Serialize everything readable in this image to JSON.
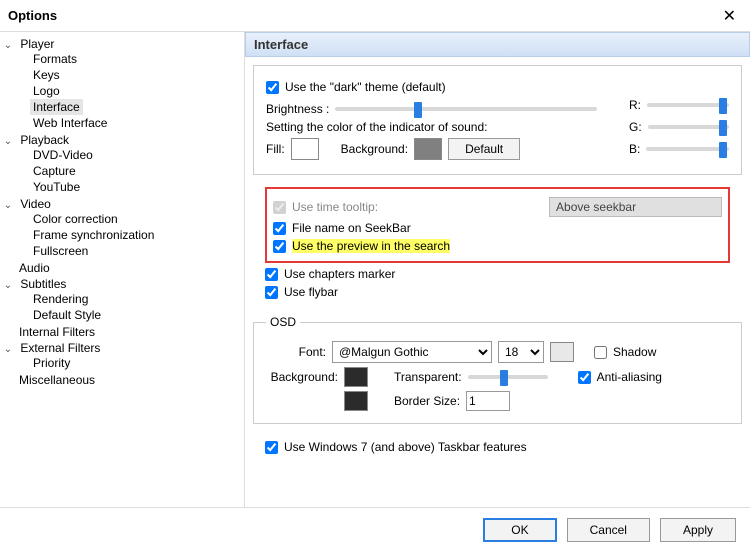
{
  "window": {
    "title": "Options",
    "close": "✕"
  },
  "tree": {
    "player": {
      "label": "Player",
      "items": [
        "Formats",
        "Keys",
        "Logo",
        "Interface",
        "Web Interface"
      ]
    },
    "playback": {
      "label": "Playback",
      "items": [
        "DVD-Video",
        "Capture",
        "YouTube"
      ]
    },
    "video": {
      "label": "Video",
      "items": [
        "Color correction",
        "Frame synchronization",
        "Fullscreen"
      ]
    },
    "audio": {
      "label": "Audio"
    },
    "subtitles": {
      "label": "Subtitles",
      "items": [
        "Rendering",
        "Default Style"
      ]
    },
    "internal_filters": {
      "label": "Internal Filters"
    },
    "external_filters": {
      "label": "External Filters",
      "items": [
        "Priority"
      ]
    },
    "misc": {
      "label": "Miscellaneous"
    }
  },
  "header": "Interface",
  "theme": {
    "dark_label": "Use the \"dark\" theme (default)",
    "brightness_label": "Brightness :",
    "color_setting_label": "Setting the color of the indicator of sound:",
    "fill_label": "Fill:",
    "bg_label": "Background:",
    "default_btn": "Default",
    "r": "R:",
    "g": "G:",
    "b": "B:",
    "fill_color": "#ffffff",
    "bg_color": "#808080"
  },
  "seekbar": {
    "tooltip_label": "Use time tooltip:",
    "tooltip_value": "Above seekbar",
    "filename_label": "File name on SeekBar",
    "preview_label": "Use the preview in the search",
    "chapters_label": "Use chapters marker",
    "flybar_label": "Use flybar"
  },
  "osd": {
    "legend": "OSD",
    "font_label": "Font:",
    "font_value": "@Malgun Gothic",
    "size_value": "18",
    "shadow_label": "Shadow",
    "aa_label": "Anti-aliasing",
    "bg_label": "Background:",
    "transparent_label": "Transparent:",
    "border_label": "Border Size:",
    "border_value": "1",
    "swatch_color": "#2b2b2b"
  },
  "taskbar": {
    "label": "Use Windows 7 (and above) Taskbar features"
  },
  "buttons": {
    "ok": "OK",
    "cancel": "Cancel",
    "apply": "Apply"
  }
}
